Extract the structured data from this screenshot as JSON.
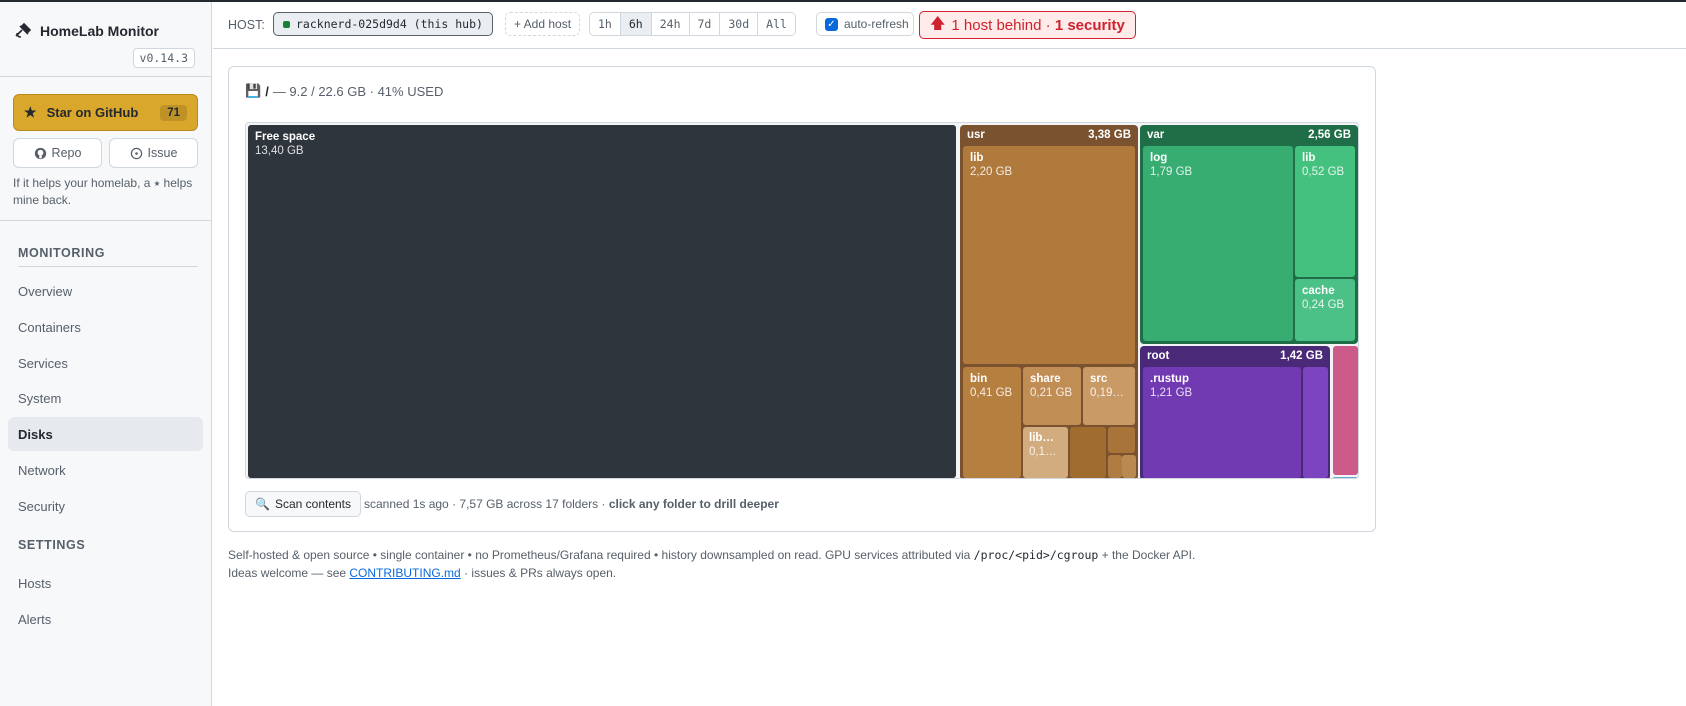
{
  "app": {
    "title": "HomeLab Monitor",
    "version": "v0.14.3"
  },
  "sidebar": {
    "star_label": "Star on GitHub",
    "star_count": "71",
    "repo_label": "Repo",
    "issue_label": "Issue",
    "help_text": "If it helps your homelab, a ⭑ helps mine back.",
    "monitoring_heading": "MONITORING",
    "settings_heading": "SETTINGS",
    "monitoring_items": [
      "Overview",
      "Containers",
      "Services",
      "System",
      "Disks",
      "Network",
      "Security"
    ],
    "settings_items": [
      "Hosts",
      "Alerts"
    ],
    "active_item": "Disks"
  },
  "topbar": {
    "host_label": "HOST:",
    "host_value": "racknerd-025d9d4 (this hub)",
    "add_host": "+ Add host",
    "ranges": [
      "1h",
      "6h",
      "24h",
      "7d",
      "30d",
      "All"
    ],
    "active_range": "6h",
    "auto_refresh_label": "auto-refresh",
    "auto_refresh_checked": true,
    "alert_prefix": "1 host behind · ",
    "alert_bold": "1 security",
    "alert_color": "#cf222e"
  },
  "disk": {
    "mount": "/",
    "usage": "— 9.2 / 22.6 GB · 41% USED"
  },
  "treemap": {
    "free": {
      "name": "Free space",
      "size": "13,40 GB",
      "color": "#2f353d"
    },
    "usr": {
      "name": "usr",
      "size": "3,38 GB",
      "color": "#7a5230",
      "children": [
        {
          "name": "lib",
          "size": "2,20 GB"
        },
        {
          "name": "bin",
          "size": "0,41 GB"
        },
        {
          "name": "share",
          "size": "0,21 GB"
        },
        {
          "name": "src",
          "size": "0,19…"
        },
        {
          "name": "lib…",
          "size": "0,1…"
        }
      ]
    },
    "var": {
      "name": "var",
      "size": "2,56 GB",
      "color": "#1f6e48",
      "children": [
        {
          "name": "log",
          "size": "1,79 GB"
        },
        {
          "name": "lib",
          "size": "0,52 GB"
        },
        {
          "name": "cache",
          "size": "0,24 GB"
        }
      ]
    },
    "root": {
      "name": "root",
      "size": "1,42 GB",
      "color": "#4a2a78",
      "children": [
        {
          "name": ".rustup",
          "size": "1,21 GB"
        }
      ]
    }
  },
  "scan": {
    "button_label": "Scan contents",
    "note_prefix": "scanned 1s ago · 7,57 GB across 17 folders · ",
    "note_bold": "click any folder to drill deeper"
  },
  "footer": {
    "line1_a": "Self-hosted & open source • single container • no Prometheus/Grafana required • history downsampled on read. GPU services attributed via ",
    "line1_code": "/proc/<pid>/cgroup",
    "line1_b": " + the Docker API.",
    "line2_a": "Ideas welcome — see ",
    "line2_link": "CONTRIBUTING.md",
    "line2_b": " · issues & PRs always open."
  }
}
